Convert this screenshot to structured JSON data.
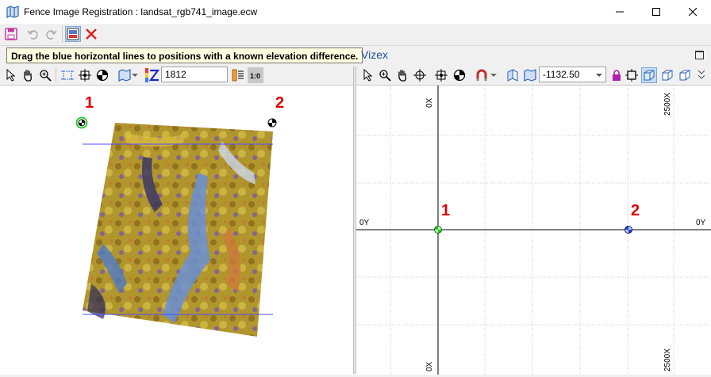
{
  "window": {
    "title": "Fence Image Registration : landsat_rgb741_image.ecw"
  },
  "tooltip": {
    "text": "Drag the blue horizontal lines to positions with a known elevation difference."
  },
  "vizex_tab": {
    "label": "Vizex"
  },
  "left_toolbar": {
    "elevation_value": "1812"
  },
  "right_toolbar": {
    "elevation_value": "-1132.50"
  },
  "left_view": {
    "point_labels": [
      "1",
      "2"
    ]
  },
  "right_view": {
    "point_labels": [
      "1",
      "2"
    ],
    "axis_labels": {
      "x_top_left": "0X",
      "x_top_right": "2500X",
      "x_bottom_left": "0X",
      "x_bottom_right": "2500X",
      "y_left": "0Y",
      "y_right": "0Y"
    }
  },
  "colors": {
    "guide_line": "#4a4aff",
    "point1": "#22c922",
    "point2": "#1f3fd6",
    "label_red": "#e00000"
  }
}
